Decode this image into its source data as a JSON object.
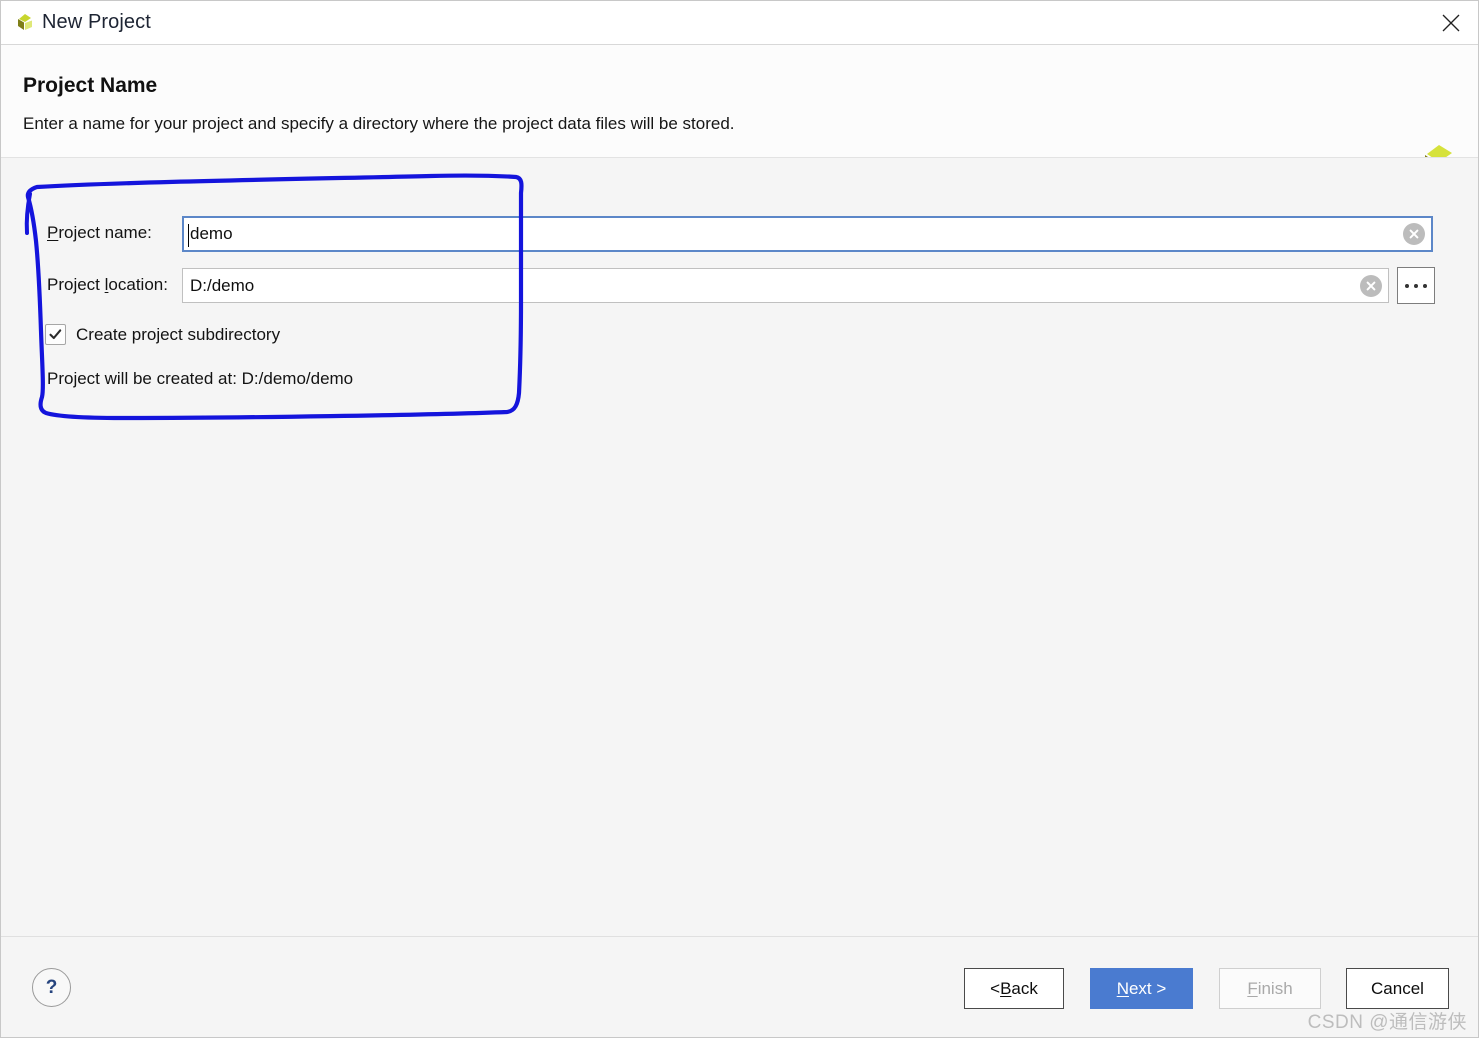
{
  "window": {
    "title": "New Project",
    "icon": "qt-logo-icon",
    "close_label": "✕"
  },
  "header": {
    "title": "Project Name",
    "subtitle": "Enter a name for your project and specify a directory where the project data files will be stored.",
    "brand_icon": "qt-pinwheel-logo"
  },
  "form": {
    "project_name": {
      "label_pre": "P",
      "label_post": "roject name:",
      "value": "demo",
      "placeholder": "",
      "clear_icon": "clear-circle-icon"
    },
    "project_location": {
      "label_pre": "Project ",
      "label_mnemonic": "l",
      "label_post": "ocation:",
      "value": "D:/demo",
      "placeholder": "",
      "clear_icon": "clear-circle-icon",
      "browse_label": "..."
    },
    "create_subdirectory": {
      "label": "Create project subdirectory",
      "checked": true
    },
    "created_at_text": "Project will be created at: D:/demo/demo"
  },
  "footer": {
    "help_label": "?",
    "buttons": {
      "back": {
        "pre": "< ",
        "mnemonic": "B",
        "post": "ack"
      },
      "next": {
        "pre": "",
        "mnemonic": "N",
        "post": "ext >"
      },
      "finish": {
        "pre": "",
        "mnemonic": "F",
        "post": "inish",
        "disabled": true
      },
      "cancel": {
        "pre": "",
        "mnemonic": "",
        "post": "Cancel"
      }
    }
  },
  "watermark": "CSDN @通信游侠",
  "colors": {
    "accent_blue": "#4a7bd0",
    "focus_border": "#5c87c8",
    "annotation": "#1414dc",
    "brand_olive": "#7f7f18",
    "brand_yellow": "#d6e23c",
    "help_blue": "#26447e"
  }
}
